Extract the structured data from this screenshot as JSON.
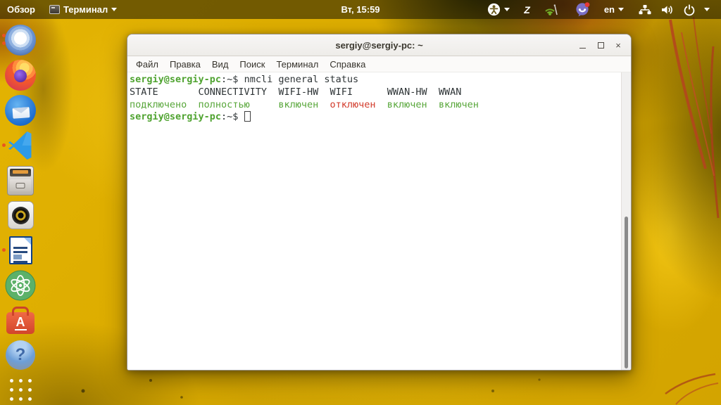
{
  "top_bar": {
    "activities_label": "Обзор",
    "focused_app": "Терминал",
    "clock": "Вт, 15:59",
    "language": "en"
  },
  "glyphs": {
    "close": "×",
    "z": "Z"
  },
  "window": {
    "title": "sergiy@sergiy-pc: ~",
    "menu": {
      "file": "Файл",
      "edit": "Правка",
      "view": "Вид",
      "search": "Поиск",
      "terminal": "Терминал",
      "help": "Справка"
    }
  },
  "terminal": {
    "prompt_user": "sergiy@sergiy-pc",
    "prompt_suffix": ":~$ ",
    "command": "nmcli general status",
    "header_row": "STATE       CONNECTIVITY  WIFI-HW  WIFI      WWAN-HW  WWAN",
    "status": {
      "state": "подключено  ",
      "connectivity": "полностью     ",
      "wifi_hw": "включен  ",
      "wifi": "отключен  ",
      "wwan_hw": "включен  ",
      "wwan": "включен"
    }
  },
  "dock": {
    "question_glyph": "?",
    "toolbox_letter": "A"
  },
  "colors": {
    "accent_orange": "#E95420",
    "prompt_green": "#4FA330",
    "status_green": "#57A639",
    "status_red": "#D23A2A",
    "terminal_text": "#2E3436",
    "menubar_bg": "#FBFAF9",
    "signal_green": "#76B82A",
    "viber_purple": "#7B6FC4",
    "badge_red": "#E53935"
  }
}
